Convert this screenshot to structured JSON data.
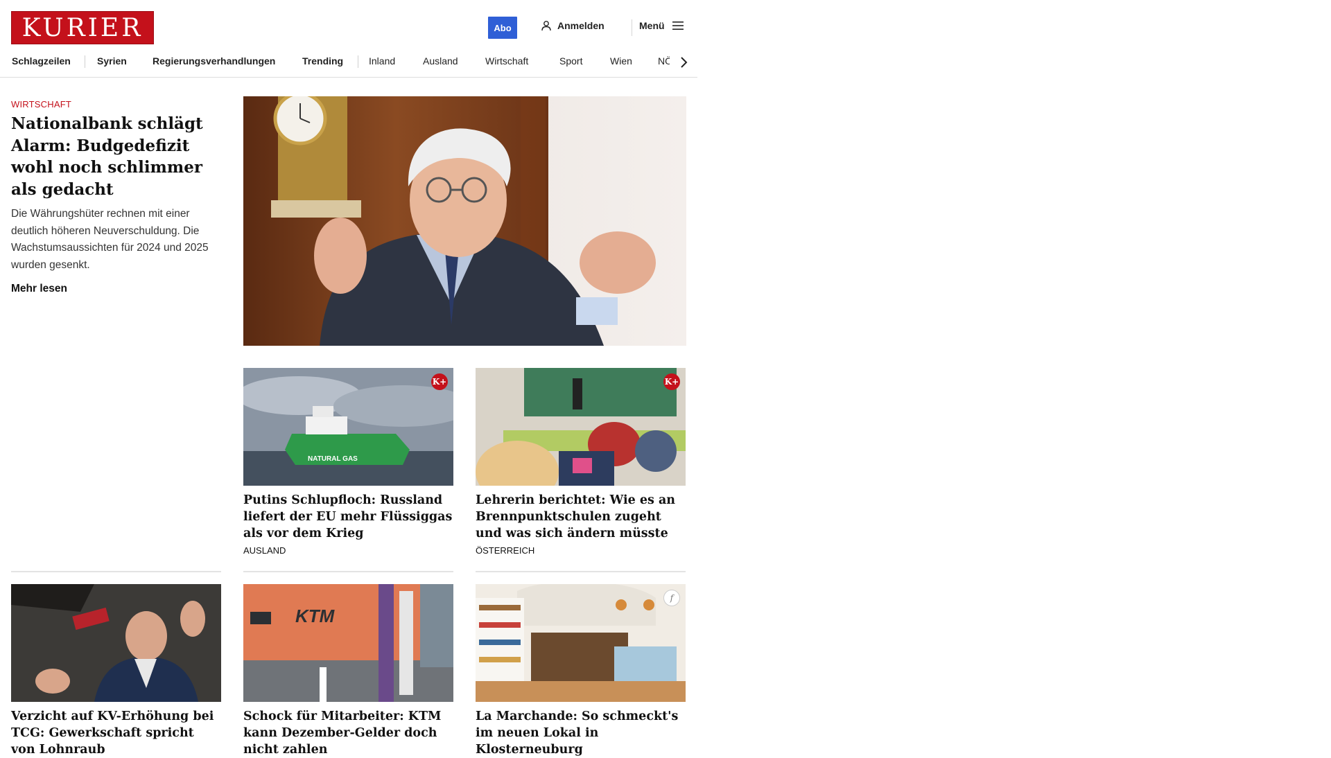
{
  "header": {
    "logo": "KURIER",
    "abo_label": "Abo",
    "login_label": "Anmelden",
    "menu_label": "Menü"
  },
  "nav": {
    "items": [
      "Schlagzeilen",
      "Syrien",
      "Regierungsverhandlungen",
      "Trending",
      "Inland",
      "Ausland",
      "Wirtschaft",
      "Sport",
      "Wien",
      "NÖ"
    ]
  },
  "lead": {
    "kicker": "WIRTSCHAFT",
    "title": "Nationalbank schlägt Alarm: Budgedefizit wohl noch schlimmer als gedacht",
    "text": "Die Währungshüter rechnen mit einer deutlich höheren Neuverschuldung. Die Wachstumsaussichten für 2024 und 2025 wurden gesenkt.",
    "more": "Mehr lesen"
  },
  "teasers": [
    {
      "title": "Putins Schlupfloch: Russland lie­fert der EU mehr Flüssiggas als vor dem Krieg",
      "category": "AUSLAND",
      "badge": "K+",
      "ship_text": "NATURAL GAS"
    },
    {
      "title": "Lehrerin berichtet: Wie es an Brennpunktschulen zugeht und was sich ändern müsste",
      "category": "ÖSTERREICH",
      "badge": "K+"
    },
    {
      "title": "Verzicht auf KV-Erhöhung bei TCG: Gewerkschaft spricht von Lohnraub",
      "category": ""
    },
    {
      "title": "Schock für Mitarbeiter: KTM kann Dezember-Gelder doch nicht zahlen",
      "category": "",
      "sign_text": "KTM"
    },
    {
      "title": "La Marchande: So schmeckt's im neuen Lokal in Klosterneuburg",
      "category": "",
      "badge": "f"
    }
  ]
}
